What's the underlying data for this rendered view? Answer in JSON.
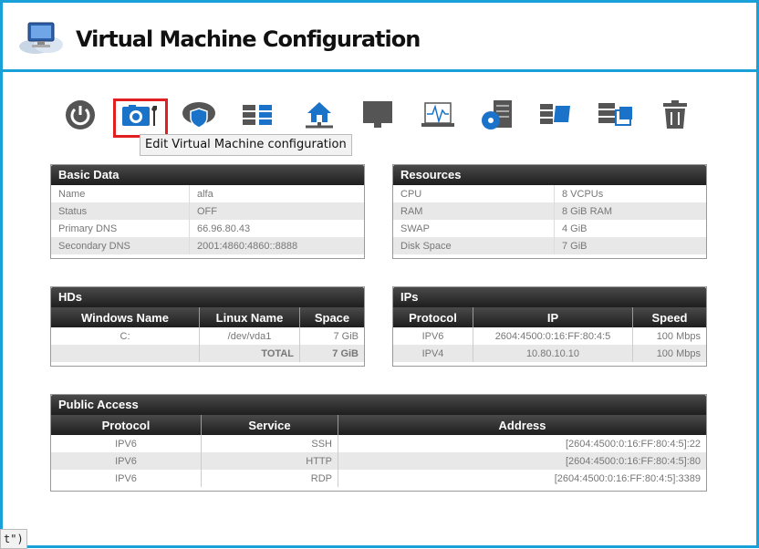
{
  "header": {
    "title": "Virtual Machine Configuration",
    "logo_icon": "cloud-computer-icon"
  },
  "toolbar": {
    "items": [
      {
        "name": "power-button",
        "icon": "power-icon"
      },
      {
        "name": "edit-configuration-button",
        "icon": "camera-wrench-icon",
        "selected": true
      },
      {
        "name": "security-cloud-button",
        "icon": "cloud-shield-icon"
      },
      {
        "name": "network-servers-button",
        "icon": "servers-icon"
      },
      {
        "name": "home-network-button",
        "icon": "home-network-icon"
      },
      {
        "name": "console-button",
        "icon": "monitor-icon"
      },
      {
        "name": "monitoring-button",
        "icon": "activity-graph-icon"
      },
      {
        "name": "storage-button",
        "icon": "disk-server-icon"
      },
      {
        "name": "migrate-button",
        "icon": "server-transfer-icon"
      },
      {
        "name": "snapshot-button",
        "icon": "server-copy-icon"
      },
      {
        "name": "delete-button",
        "icon": "trash-icon"
      }
    ],
    "tooltip": "Edit Virtual Machine configuration"
  },
  "basic_data": {
    "title": "Basic Data",
    "rows": [
      {
        "k": "Name",
        "v": "alfa"
      },
      {
        "k": "Status",
        "v": "OFF"
      },
      {
        "k": "Primary DNS",
        "v": "66.96.80.43"
      },
      {
        "k": "Secondary DNS",
        "v": "2001:4860:4860::8888"
      }
    ]
  },
  "resources": {
    "title": "Resources",
    "rows": [
      {
        "k": "CPU",
        "v": "8 VCPUs"
      },
      {
        "k": "RAM",
        "v": "8 GiB RAM"
      },
      {
        "k": "SWAP",
        "v": "4 GiB"
      },
      {
        "k": "Disk Space",
        "v": "7 GiB"
      }
    ]
  },
  "hds": {
    "title": "HDs",
    "headers": [
      "Windows Name",
      "Linux Name",
      "Space"
    ],
    "rows": [
      [
        "C:",
        "/dev/vda1",
        "7 GiB"
      ]
    ],
    "total_label": "TOTAL",
    "total_value": "7 GiB"
  },
  "ips": {
    "title": "IPs",
    "headers": [
      "Protocol",
      "IP",
      "Speed"
    ],
    "rows": [
      [
        "IPV6",
        "2604:4500:0:16:FF:80:4:5",
        "100 Mbps"
      ],
      [
        "IPV4",
        "10.80.10.10",
        "100 Mbps"
      ]
    ]
  },
  "public_access": {
    "title": "Public Access",
    "headers": [
      "Protocol",
      "Service",
      "Address"
    ],
    "rows": [
      [
        "IPV6",
        "SSH",
        "[2604:4500:0:16:FF:80:4:5]:22"
      ],
      [
        "IPV6",
        "HTTP",
        "[2604:4500:0:16:FF:80:4:5]:80"
      ],
      [
        "IPV6",
        "RDP",
        "[2604:4500:0:16:FF:80:4:5]:3389"
      ]
    ]
  },
  "status_fragment": "t\")",
  "colors": {
    "accent": "#1aa0d8",
    "selection": "#e02020",
    "icon_gray": "#555555",
    "icon_blue": "#1a73c8"
  }
}
